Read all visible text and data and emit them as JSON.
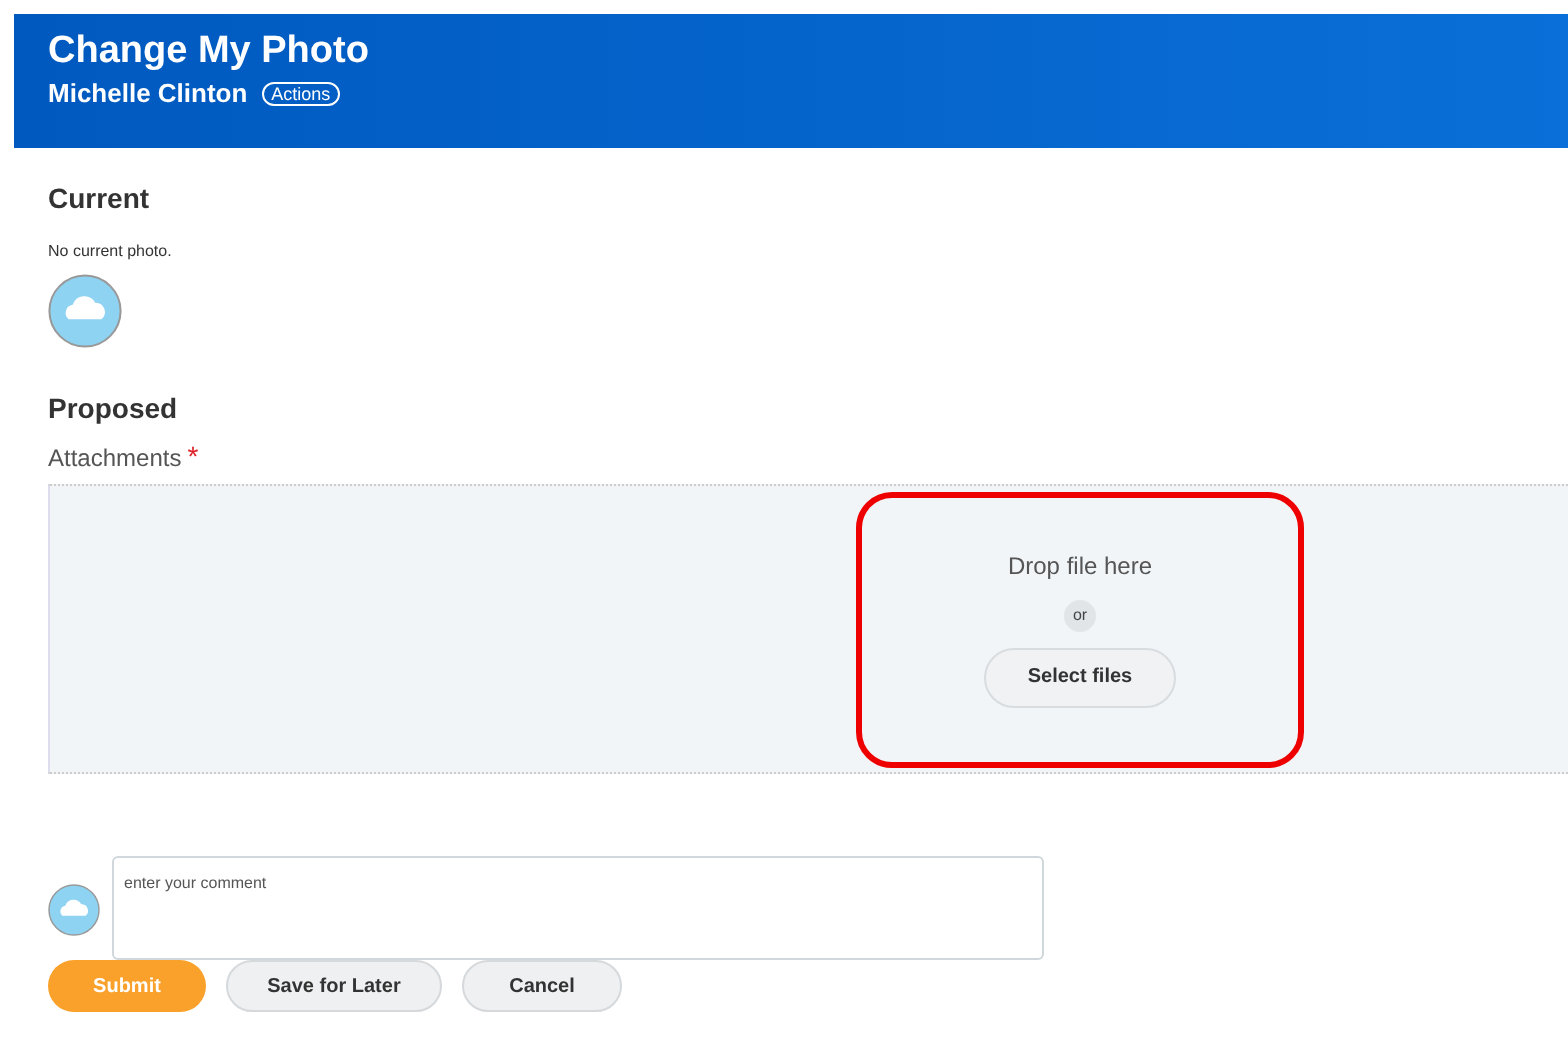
{
  "header": {
    "title": "Change My Photo",
    "subtitle": "Michelle Clinton",
    "actions_button": "Actions"
  },
  "current": {
    "heading": "Current",
    "note": "No current photo."
  },
  "proposed": {
    "heading": "Proposed",
    "field_label": "Attachments",
    "required_mark": "*",
    "dropzone": {
      "prompt": "Drop file here",
      "separator": "or",
      "button": "Select files",
      "highlighted": true
    }
  },
  "comment": {
    "placeholder": "enter your comment"
  },
  "buttons": [
    {
      "label": "Submit",
      "kind": "primary"
    },
    {
      "label": "Save for Later",
      "kind": "secondary"
    },
    {
      "label": "Cancel",
      "kind": "secondary"
    }
  ]
}
